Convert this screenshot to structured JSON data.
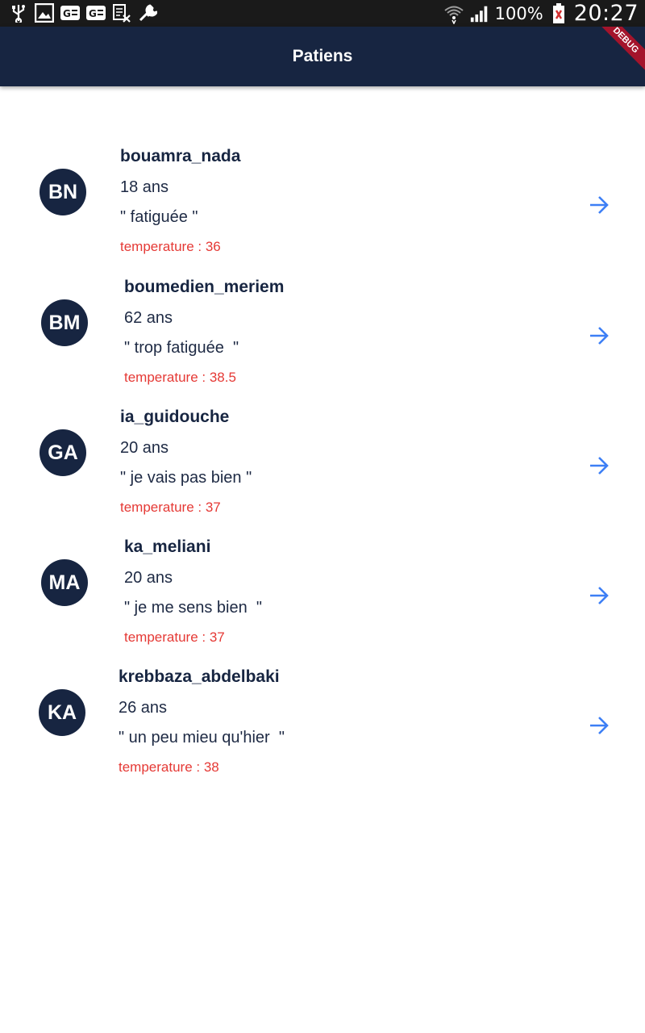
{
  "status_bar": {
    "battery": "100%",
    "time": "20:27"
  },
  "app_bar": {
    "title": "Patiens",
    "debug_banner": "DEBUG"
  },
  "patients": [
    {
      "initials": "BN",
      "name": "bouamra_nada",
      "age": "18 ans",
      "note": "\" fatiguée \"",
      "temperature": "temperature : 36"
    },
    {
      "initials": "BM",
      "name": "boumedien_meriem",
      "age": "62 ans",
      "note": "\" trop fatiguée  \"",
      "temperature": "temperature : 38.5"
    },
    {
      "initials": "GA",
      "name": "ia_guidouche",
      "age": "20 ans",
      "note": "\" je vais pas bien \"",
      "temperature": "temperature : 37"
    },
    {
      "initials": "MA",
      "name": "ka_meliani",
      "age": "20 ans",
      "note": "\" je me sens bien  \"",
      "temperature": "temperature : 37"
    },
    {
      "initials": "KA",
      "name": "krebbaza_abdelbaki",
      "age": "26 ans",
      "note": "\" un peu mieu qu'hier  \"",
      "temperature": "temperature : 38"
    }
  ],
  "colors": {
    "primary": "#172541",
    "accent_arrow": "#3d7ff5",
    "temperature": "#e53935"
  },
  "icons": {
    "row_action": "arrow-forward-icon"
  }
}
